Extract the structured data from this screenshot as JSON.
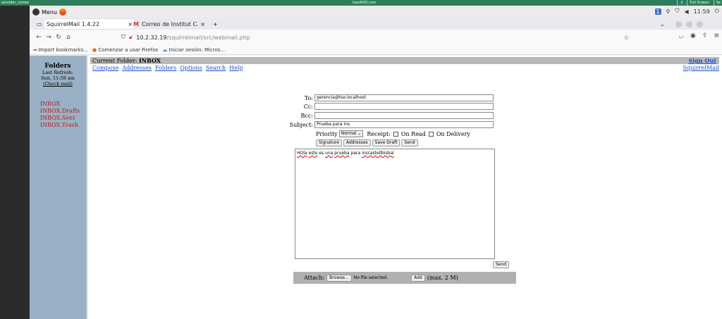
{
  "topbar": {
    "left": "servidor_correo",
    "center": "IsardVDI.com",
    "full": "Full Screen",
    "end": "Se"
  },
  "os": {
    "menu": "Menu",
    "time": "11:59"
  },
  "tabs": [
    {
      "label": "SquirrelMail 1.4.22"
    },
    {
      "label": "Correo de Institut Castell"
    }
  ],
  "url": {
    "host": "10.2.32.19",
    "path": "/squirrelmail/src/webmail.php"
  },
  "bookmarks": [
    "Import bookmarks...",
    "Comenzar a usar Firefox",
    "Iniciar sesión: Micros..."
  ],
  "sidebar": {
    "title": "Folders",
    "last_refresh_label": "Last Refresh:",
    "last_refresh_time": "Sun, 11:58 am",
    "check_mail": "(Check mail)",
    "folders": [
      "INBOX",
      "INBOX.Drafts",
      "INBOX.Sent",
      "INBOX.Trash"
    ]
  },
  "main": {
    "current_folder_label": "Current Folder: ",
    "current_folder": "INBOX",
    "sign_out": "Sign Out",
    "brand": "SquirrelMail",
    "links": [
      "Compose",
      "Addresses",
      "Folders",
      "Options",
      "Search",
      "Help"
    ]
  },
  "compose": {
    "to_label": "To:",
    "to_value": "gerencia@tso.localhost",
    "cc_label": "Cc:",
    "bcc_label": "Bcc:",
    "subject_label": "Subject:",
    "subject_value": "Prueba para ins",
    "priority_label": "Priority",
    "priority_value": "Normal",
    "receipt_label": "Receipt:",
    "on_read": "On Read",
    "on_delivery": "On Delivery",
    "buttons": [
      "Signature",
      "Addresses",
      "Save Draft",
      "Send"
    ],
    "body_words": [
      "HOla",
      "esto",
      "es",
      "una",
      "prueba",
      "para",
      "inscastellbisbal"
    ],
    "send_bottom": "Send",
    "attach_label": "Attach:",
    "browse": "Browse...",
    "no_file": "No file selected.",
    "add": "Add",
    "max": "(max. 2 M)"
  }
}
